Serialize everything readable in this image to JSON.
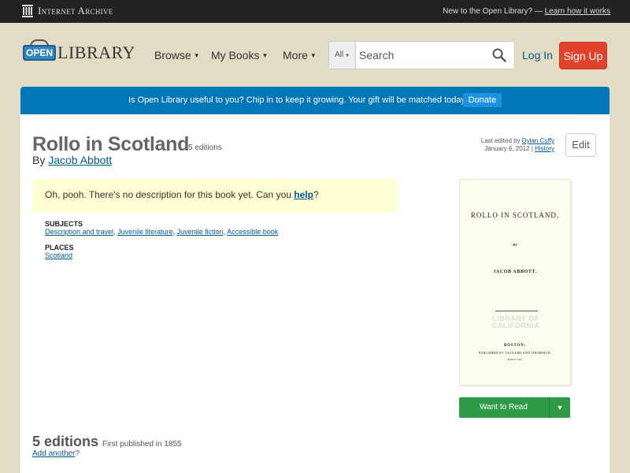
{
  "ia_bar": {
    "brand": "Internet Archive",
    "new_text": "New to the Open Library? —",
    "learn_link": "Learn how it works"
  },
  "header": {
    "logo_badge": "OPEN",
    "logo_word": "LIBRARY",
    "nav": [
      {
        "label": "Browse"
      },
      {
        "label": "My Books"
      },
      {
        "label": "More"
      }
    ],
    "search": {
      "scope": "All",
      "placeholder": "Search",
      "icon": "search-icon"
    },
    "login": "Log In",
    "signup": "Sign Up"
  },
  "banner": {
    "text": "Is Open Library useful to you? Chip in to keep it growing. Your gift will be matched today!",
    "donate": "Donate"
  },
  "book": {
    "title": "Rollo in Scotland",
    "edition_count_label": "5 editions",
    "by": "By",
    "author": "Jacob Abbott",
    "last_edited_prefix": "Last edited by",
    "last_edited_user": "Dylan Cuffy",
    "last_edited_date": "January 6, 2012",
    "separator": "|",
    "history": "History",
    "edit": "Edit",
    "description_prefix": "Oh, pooh. There's no description for this book yet. Can you",
    "description_link": "help",
    "description_suffix": "?",
    "subjects_label": "SUBJECTS",
    "subjects": [
      "Description and travel",
      "Juvenile literature",
      "Juvenile fiction",
      "Accessible book"
    ],
    "places_label": "PLACES",
    "places": [
      "Scotland"
    ]
  },
  "cover": {
    "title": "ROLLO IN SCOTLAND,",
    "by": "BY",
    "author": "JACOB ABBOTT.",
    "stamp": "LIBRARY OF CALIFORNIA",
    "city": "BOSTON:",
    "publisher": "PUBLISHED BY TAGGARD AND THOMPSON.",
    "year": "M DCCC LXV."
  },
  "want_to_read": {
    "label": "Want to Read",
    "dropdown_icon": "caret-down-icon"
  },
  "editions": {
    "heading": "5 editions",
    "first_published": "First published in 1855",
    "add_another": "Add another",
    "add_suffix": "?"
  },
  "colors": {
    "page_bg": "#e2dcc5",
    "ia_bar": "#222222",
    "banner": "#0376b8",
    "signup": "#e2422a",
    "want_to_read": "#2e9b48",
    "link": "#02598b",
    "description_bg": "#ffffd3"
  }
}
